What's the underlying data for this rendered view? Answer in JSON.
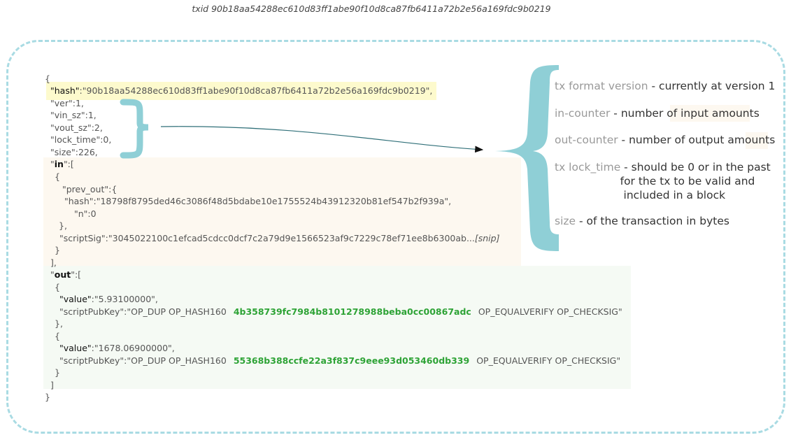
{
  "title": "txid 90b18aa54288ec610d83ff1abe90f10d8ca87fb6411a72b2e56a169fdc9b0219",
  "json_view": {
    "open_brace": "{",
    "close_brace": "}",
    "hash_key": "\"hash\"",
    "hash_value": ":\"90b18aa54288ec610d83ff1abe90f10d8ca87fb6411a72b2e56a169fdc9b0219\",",
    "ver": "\"ver\":1,",
    "vin_sz": "\"vin_sz\":1,",
    "vout_sz": "\"vout_sz\":2,",
    "lock_time": "\"lock_time\":0,",
    "size": "\"size\":226,",
    "in_quote": "\"",
    "in_key": "in",
    "in_rest": "\":[",
    "in_item_open": "{",
    "prev_out": "\"prev_out\":{",
    "prev_hash": "\"hash\":\"18798f8795ded46c3086f48d5bdabe10e1755524b43912320b81ef547b2f939a\",",
    "prev_n": "\"n\":0",
    "prev_out_close": "},",
    "scriptsig": "\"scriptSig\":\"3045022100c1efcad5cdcc0dcf7c2a79d9e1566523af9c7229c78ef71ee8b6300ab...",
    "snip": "[snip]",
    "in_item_close": "}",
    "in_close": "],",
    "out_quote": "\"",
    "out_key": "out",
    "out_rest": "\":[",
    "out_items": [
      {
        "open": "{",
        "value_key": "\"value\"",
        "value_rest": ":\"5.93100000\",",
        "spk_prefix": "\"scriptPubKey\":\"OP_DUP OP_HASH160",
        "spk_hash": "4b358739fc7984b8101278988beba0cc00867adc",
        "spk_suffix": "OP_EQUALVERIFY OP_CHECKSIG\"",
        "close": "},"
      },
      {
        "open": "{",
        "value_key": "\"value\"",
        "value_rest": ":\"1678.06900000\",",
        "spk_prefix": "\"scriptPubKey\":\"OP_DUP OP_HASH160",
        "spk_hash": "55368b388ccfe22a3f837c9eee93d053460db339",
        "spk_suffix": "OP_EQUALVERIFY OP_CHECKSIG\"",
        "close": "}"
      }
    ],
    "out_close": "]"
  },
  "descriptions": [
    {
      "label": "tx format version",
      "text": " - currently at version 1"
    },
    {
      "label": "in-counter",
      "text": " - number of input amounts"
    },
    {
      "label": "out-counter",
      "text": " - number of output amounts"
    },
    {
      "label": "tx lock_time",
      "text": " - should be 0 or in the past\n                   for the tx to be valid and\n                    included in a block"
    },
    {
      "label": "size",
      "text": " - of the transaction in bytes"
    }
  ],
  "colors": {
    "border": "#a9dbe3",
    "brace": "#8fcfd6",
    "hash_highlight": "#fdfacd",
    "in_highlight": "#fdf8f0",
    "out_highlight": "#f5faf4",
    "address_green": "#2ea336"
  }
}
